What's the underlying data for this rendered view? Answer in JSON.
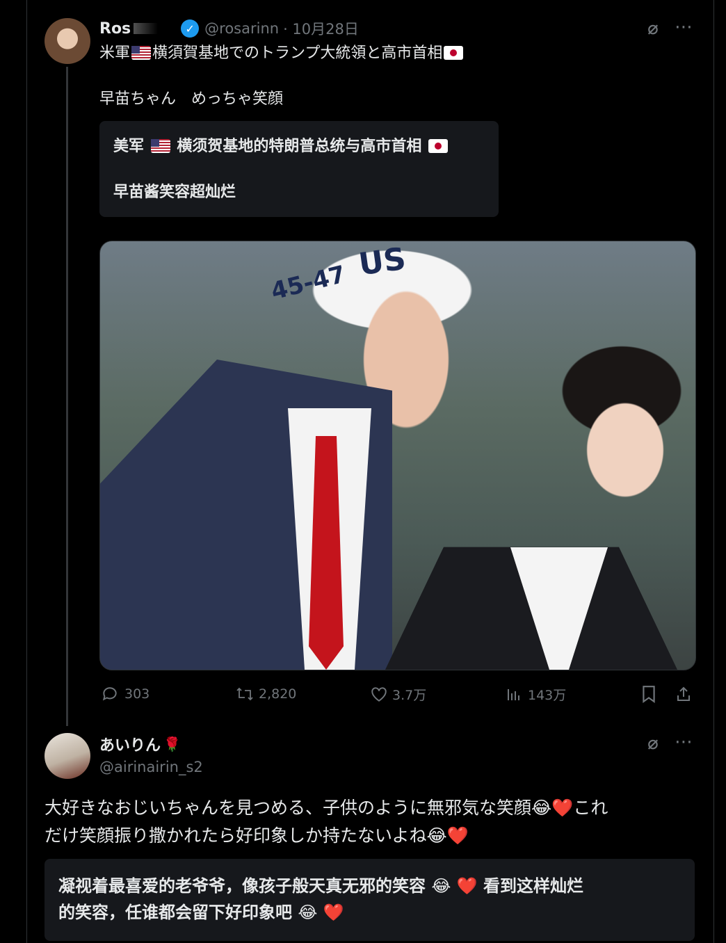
{
  "tweet": {
    "author_name": "Ros",
    "author_handle": "@rosarinn",
    "date": "· 10月28日",
    "line1_a": "米軍",
    "line1_b": "横須賀基地でのトランプ大統領と高市首相",
    "line2": "早苗ちゃん　めっちゃ笑顔",
    "translation_line1_a": "美军",
    "translation_line1_b": "横须贺基地的特朗普总统与高市首相",
    "translation_line2": "早苗酱笑容超灿烂",
    "image_text_1": "45-47",
    "image_text_2": "US",
    "stats": {
      "replies": "303",
      "retweets": "2,820",
      "likes": "3.7万",
      "views": "143万"
    }
  },
  "reply": {
    "author_name": "あいりん",
    "author_emoji": "🌹",
    "author_handle": "@airinairin_s2",
    "text_line1": "大好きなおじいちゃんを見つめる、子供のように無邪気な笑顔😂❤️これ",
    "text_line2": "だけ笑顔振り撒かれたら好印象しか持たないよね😂❤️",
    "translation_line1": "凝视着最喜爱的老爷爷，像孩子般天真无邪的笑容 😂 ❤️ 看到这样灿烂",
    "translation_line2": "的笑容，任谁都会留下好印象吧 😂 ❤️"
  },
  "icons": [
    "grok-icon",
    "more-icon",
    "verified-icon",
    "reply-icon",
    "retweet-icon",
    "like-icon",
    "views-icon",
    "bookmark-icon",
    "share-icon"
  ],
  "colors": {
    "background": "#000000",
    "text": "#e7e9ea",
    "muted": "#71767b",
    "verified": "#1d9bf0",
    "card": "#16181c"
  }
}
